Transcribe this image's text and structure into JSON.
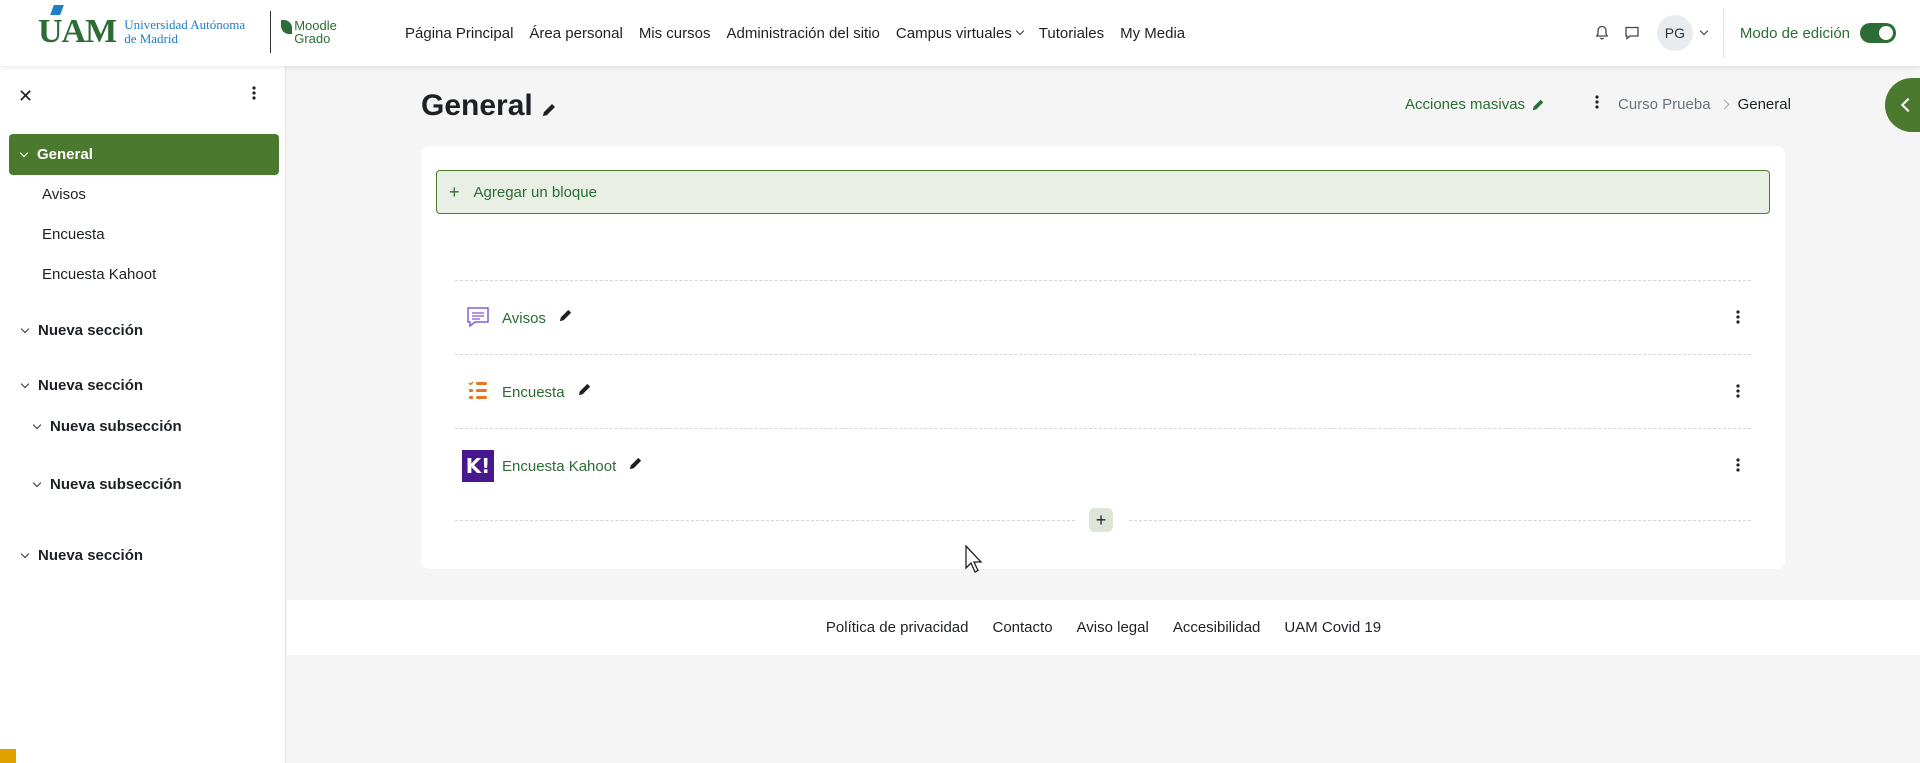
{
  "logo": {
    "uam": "UAM",
    "university_line1": "Universidad Autónoma",
    "university_line2": "de Madrid",
    "moodle_line1": "Moodle",
    "moodle_line2": "Grado"
  },
  "nav": {
    "items": [
      {
        "label": "Página Principal"
      },
      {
        "label": "Área personal"
      },
      {
        "label": "Mis cursos"
      },
      {
        "label": "Administración del sitio"
      },
      {
        "label": "Campus virtuales"
      },
      {
        "label": "Tutoriales"
      },
      {
        "label": "My Media"
      }
    ],
    "avatar_initials": "PG",
    "edit_mode_label": "Modo de edición",
    "edit_mode_on": true
  },
  "drawer": {
    "active_section": "General",
    "items": [
      {
        "label": "Avisos"
      },
      {
        "label": "Encuesta"
      },
      {
        "label": "Encuesta Kahoot"
      }
    ],
    "sections": [
      {
        "label": "Nueva sección"
      },
      {
        "label": "Nueva sección"
      },
      {
        "label": "Nueva subsección"
      },
      {
        "label": "Nueva subsección"
      },
      {
        "label": "Nueva sección"
      }
    ]
  },
  "main": {
    "title": "General",
    "bulk_actions": "Acciones masivas",
    "breadcrumb": {
      "parent": "Curso Prueba",
      "current": "General"
    },
    "add_block": "Agregar un bloque",
    "activities": [
      {
        "name": "Avisos",
        "icon": "forum-icon"
      },
      {
        "name": "Encuesta",
        "icon": "feedback-icon"
      },
      {
        "name": "Encuesta Kahoot",
        "icon": "kahoot-icon"
      }
    ]
  },
  "footer": {
    "links": [
      {
        "label": "Política de privacidad"
      },
      {
        "label": "Contacto"
      },
      {
        "label": "Aviso legal"
      },
      {
        "label": "Accesibilidad"
      },
      {
        "label": "UAM Covid 19"
      }
    ]
  },
  "colors": {
    "brand_green": "#2b6d34",
    "active_green": "#4b7a2e",
    "uam_blue": "#1f7fc4",
    "kahoot_purple": "#46178f",
    "feedback_orange": "#e8741e",
    "forum_purple": "#8a5cd6"
  }
}
